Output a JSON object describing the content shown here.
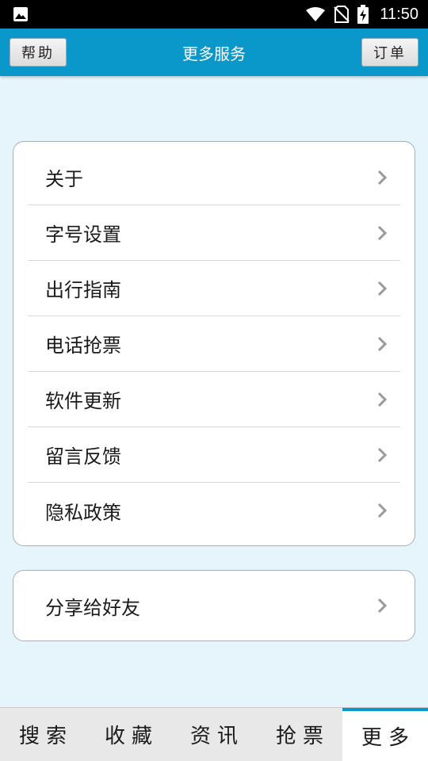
{
  "status_bar": {
    "time": "11:50",
    "icons": [
      "image-icon",
      "wifi-icon",
      "no-sim-icon",
      "battery-charging-icon"
    ]
  },
  "header": {
    "title": "更多服务",
    "left_button": "帮助",
    "right_button": "订单"
  },
  "menu": {
    "items": [
      {
        "label": "关于"
      },
      {
        "label": "字号设置"
      },
      {
        "label": "出行指南"
      },
      {
        "label": "电话抢票"
      },
      {
        "label": "软件更新"
      },
      {
        "label": "留言反馈"
      },
      {
        "label": "隐私政策"
      }
    ]
  },
  "share": {
    "label": "分享给好友"
  },
  "tabs": [
    {
      "label": "搜索",
      "active": false
    },
    {
      "label": "收藏",
      "active": false
    },
    {
      "label": "资讯",
      "active": false
    },
    {
      "label": "抢票",
      "active": false
    },
    {
      "label": "更多",
      "active": true
    }
  ],
  "colors": {
    "accent": "#0a98cb",
    "background": "#e6f5fc",
    "card_border": "#a9aeb1"
  }
}
